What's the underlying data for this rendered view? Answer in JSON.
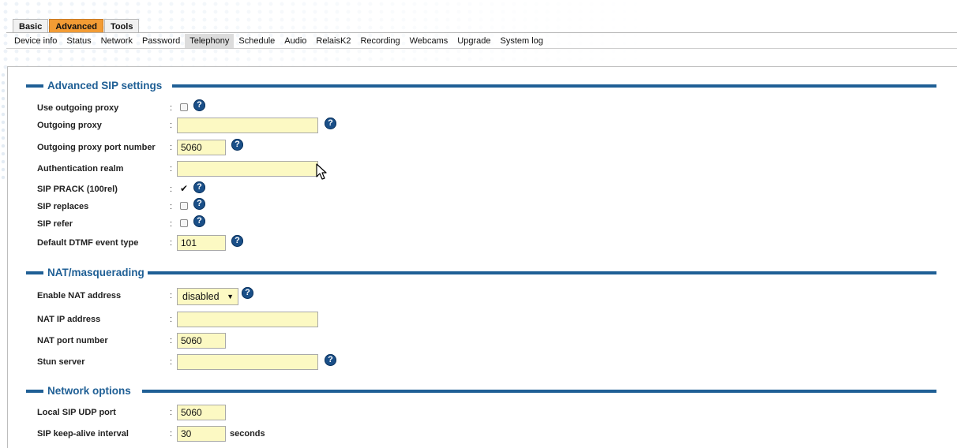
{
  "tabs": [
    {
      "label": "Basic",
      "active": false
    },
    {
      "label": "Advanced",
      "active": true
    },
    {
      "label": "Tools",
      "active": false
    }
  ],
  "subnav": [
    {
      "label": "Device info"
    },
    {
      "label": "Status"
    },
    {
      "label": "Network"
    },
    {
      "label": "Password"
    },
    {
      "label": "Telephony",
      "active": true
    },
    {
      "label": "Schedule"
    },
    {
      "label": "Audio"
    },
    {
      "label": "RelaisK2"
    },
    {
      "label": "Recording"
    },
    {
      "label": "Webcams"
    },
    {
      "label": "Upgrade"
    },
    {
      "label": "System log"
    }
  ],
  "sections": {
    "sip": {
      "title": "Advanced SIP settings",
      "use_outgoing_proxy": {
        "label": "Use outgoing proxy",
        "checked": false
      },
      "outgoing_proxy": {
        "label": "Outgoing proxy",
        "value": ""
      },
      "outgoing_proxy_port": {
        "label": "Outgoing proxy port number",
        "value": "5060"
      },
      "auth_realm": {
        "label": "Authentication realm",
        "value": ""
      },
      "sip_prack": {
        "label": "SIP PRACK (100rel)",
        "checked": true
      },
      "sip_replaces": {
        "label": "SIP replaces",
        "checked": false
      },
      "sip_refer": {
        "label": "SIP refer",
        "checked": false
      },
      "dtmf_type": {
        "label": "Default DTMF event type",
        "value": "101"
      }
    },
    "nat": {
      "title": "NAT/masquerading",
      "enable_nat": {
        "label": "Enable NAT address",
        "value": "disabled"
      },
      "nat_ip": {
        "label": "NAT IP address",
        "value": ""
      },
      "nat_port": {
        "label": "NAT port number",
        "value": "5060"
      },
      "stun": {
        "label": "Stun server",
        "value": ""
      }
    },
    "network": {
      "title": "Network options",
      "udp_port": {
        "label": "Local SIP UDP port",
        "value": "5060"
      },
      "keepalive": {
        "label": "SIP keep-alive interval",
        "value": "30",
        "suffix": "seconds"
      }
    }
  },
  "colon": ":",
  "help_glyph": "?",
  "check_glyph": "✔",
  "select_arrow": "▼",
  "colors": {
    "accent_orange": "#f39c34",
    "section_blue": "#1f5f95",
    "input_bg": "#fcf9c3",
    "help_blue": "#1a4f88"
  }
}
